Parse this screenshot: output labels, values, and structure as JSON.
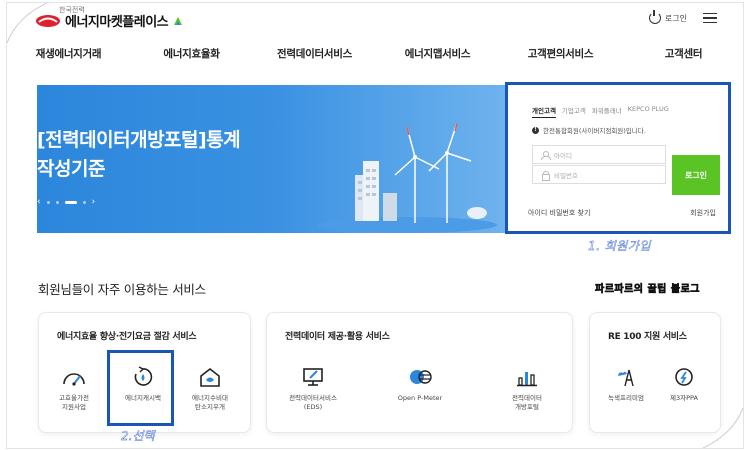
{
  "header": {
    "logo_small": "한국전력",
    "logo_text": "에너지마켓플레이스",
    "login_label": "로그인"
  },
  "nav": {
    "items": [
      "재생에너지거래",
      "에너지효율화",
      "전력데이터서비스",
      "에너지맵서비스",
      "고객편의서비스",
      "고객센터"
    ]
  },
  "hero": {
    "title_line1": "[전력데이터개방포털]통계",
    "title_line2": "작성기준",
    "prev": "‹",
    "next": "›"
  },
  "login_panel": {
    "tabs": [
      "개인고객",
      "기업고객",
      "파워플래너",
      "KEPCO PLUG"
    ],
    "notice": "한전통합회원(사이버지점회원)입니다.",
    "id_placeholder": "아이디",
    "pw_placeholder": "비밀번호",
    "login_button": "로그인",
    "find_label": "아이디 비밀번호 찾기",
    "join_label": "회원가입"
  },
  "annotations": {
    "step1": "1. 회원가입",
    "blog": "파르파르의 꿀팁 블로그",
    "step2": "2.선택"
  },
  "services": {
    "section_title": "회원님들이 자주 이용하는 서비스",
    "cards": [
      {
        "title": "에너지효율 향상·전기요금 절감 서비스",
        "items": [
          {
            "label": "고효율가전\n지원사업",
            "icon": "gauge-icon"
          },
          {
            "label": "에너지캐시백",
            "icon": "cashback-icon"
          },
          {
            "label": "에너지수비대\n탄소지우개",
            "icon": "house-leaf-icon"
          }
        ]
      },
      {
        "title": "전력데이터 제공·활용 서비스",
        "items": [
          {
            "label": "전력데이터서비스\n(EDS)",
            "icon": "monitor-icon"
          },
          {
            "label": "Open P-Meter",
            "icon": "meter-icon"
          },
          {
            "label": "전력데이터\n개방포털",
            "icon": "bar-chart-icon"
          }
        ]
      },
      {
        "title": "RE 100 지원 서비스",
        "items": [
          {
            "label": "녹색프리미엄",
            "icon": "green-premium-icon"
          },
          {
            "label": "제3자PPA",
            "icon": "compass-icon"
          }
        ]
      }
    ]
  },
  "colors": {
    "hero_blue": "#2c86db",
    "login_green": "#5bc425",
    "highlight_blue": "#1a57b5",
    "logo_red": "#e0202a"
  }
}
